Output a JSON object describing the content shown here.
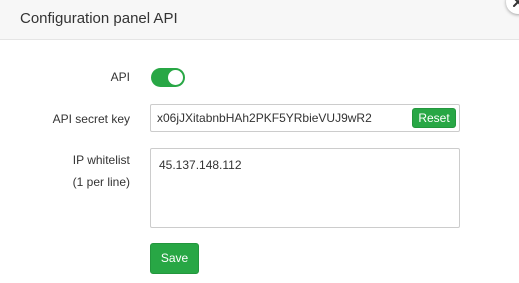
{
  "dialog": {
    "title": "Configuration panel API",
    "close_icon": "close-icon"
  },
  "form": {
    "api_label": "API",
    "api_enabled": true,
    "secret_label": "API secret key",
    "secret_value": "x06jJXitabnbHAh2PKF5YRbieVUJ9wR2",
    "reset_label": "Reset",
    "whitelist_label_line1": "IP whitelist",
    "whitelist_label_line2": "(1 per line)",
    "whitelist_value": "45.137.148.112",
    "save_label": "Save"
  },
  "colors": {
    "accent": "#28a745",
    "header_bg": "#f7f7f7"
  }
}
